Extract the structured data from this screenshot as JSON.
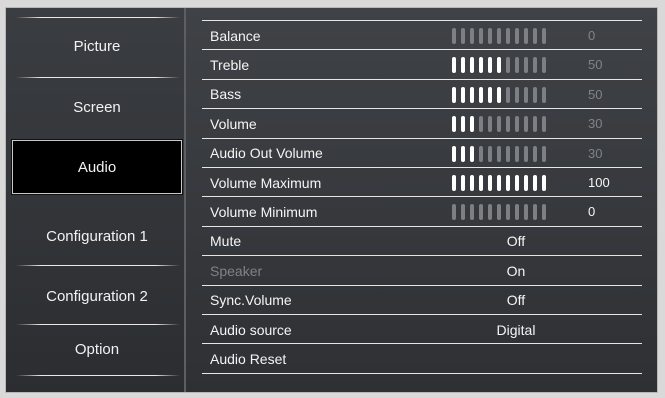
{
  "sidebar": {
    "items": [
      {
        "label": "Picture"
      },
      {
        "label": "Screen"
      },
      {
        "label": "Audio"
      },
      {
        "label": "Configuration 1"
      },
      {
        "label": "Configuration 2"
      },
      {
        "label": "Option"
      }
    ],
    "active_index": 2
  },
  "audio": {
    "rows": [
      {
        "label": "Balance",
        "type": "slider",
        "value": "0",
        "level": 0,
        "value_style": "dim"
      },
      {
        "label": "Treble",
        "type": "slider",
        "value": "50",
        "level": 0.5,
        "value_style": "dim"
      },
      {
        "label": "Bass",
        "type": "slider",
        "value": "50",
        "level": 0.5,
        "value_style": "dim"
      },
      {
        "label": "Volume",
        "type": "slider",
        "value": "30",
        "level": 0.3,
        "value_style": "dim"
      },
      {
        "label": "Audio Out Volume",
        "type": "slider",
        "value": "30",
        "level": 0.3,
        "value_style": "dim"
      },
      {
        "label": "Volume Maximum",
        "type": "slider",
        "value": "100",
        "level": 1.0,
        "value_style": "bright"
      },
      {
        "label": "Volume Minimum",
        "type": "slider",
        "value": "0",
        "level": 0,
        "value_style": "bright"
      },
      {
        "label": "Mute",
        "type": "option",
        "value": "Off"
      },
      {
        "label": "Speaker",
        "type": "option",
        "value": "On",
        "disabled": true
      },
      {
        "label": "Sync.Volume",
        "type": "option",
        "value": "Off"
      },
      {
        "label": "Audio source",
        "type": "option",
        "value": "Digital"
      },
      {
        "label": "Audio Reset",
        "type": "action"
      }
    ]
  },
  "colors": {
    "panel": "#2e3034",
    "active_bg": "#000000",
    "tick_on": "#ffffff",
    "tick_off": "#7c7f84",
    "disabled_text": "#7f8288"
  }
}
